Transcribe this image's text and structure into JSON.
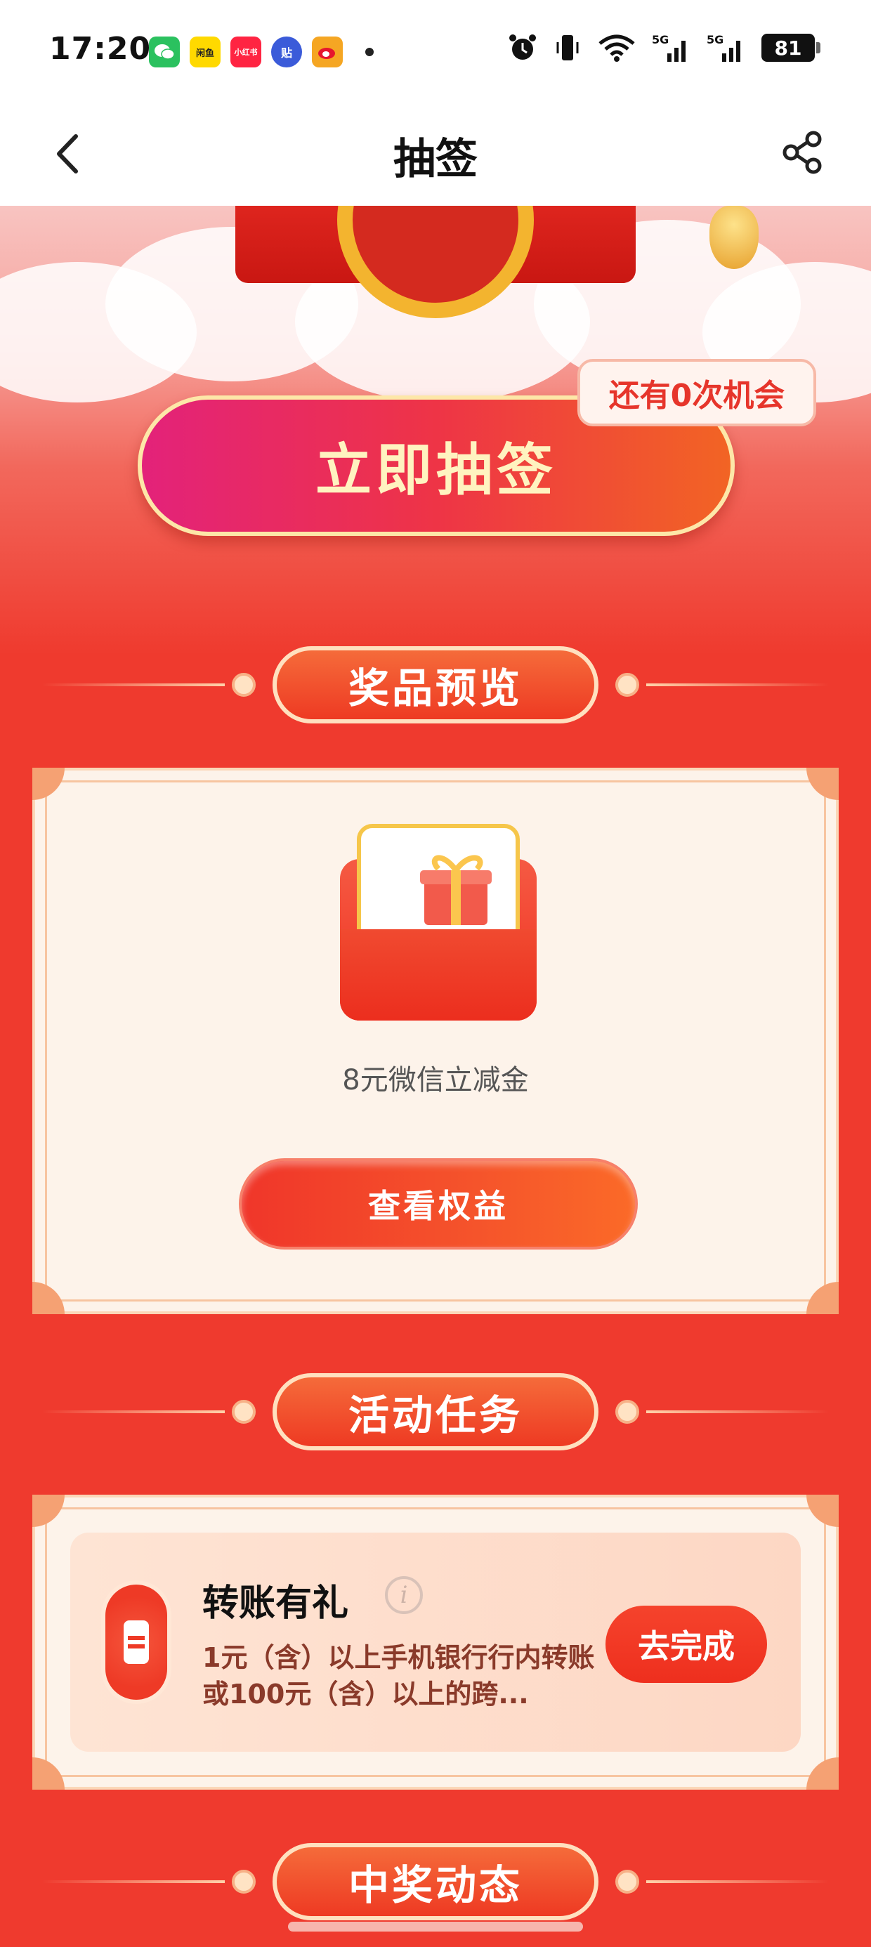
{
  "status_bar": {
    "time": "17:20",
    "apps": [
      {
        "name": "wechat-icon",
        "label": "",
        "color": "#2bc15f"
      },
      {
        "name": "xianyu-icon",
        "label": "闲鱼",
        "color": "#ffd900"
      },
      {
        "name": "xiaohongshu-icon",
        "label": "小红书",
        "color": "#ff2442"
      },
      {
        "name": "tieba-icon",
        "label": "贴",
        "color": "#3b5bd9"
      },
      {
        "name": "weibo-icon",
        "label": "",
        "color": "#f5a623"
      }
    ],
    "battery": "81",
    "signal_1": "5G",
    "signal_2": "5G"
  },
  "nav": {
    "title": "抽签"
  },
  "hero": {
    "chance_text": "还有0次机会",
    "draw_button": "立即抽签"
  },
  "prize_section": {
    "title": "奖品预览",
    "prize_name": "8元微信立减金",
    "view_button": "查看权益"
  },
  "task_section": {
    "title": "活动任务",
    "task": {
      "title": "转账有礼",
      "description": "1元（含）以上手机银行行内转账或100元（含）以上的跨...",
      "button": "去完成"
    }
  },
  "winners_section": {
    "title": "中奖动态"
  },
  "colors": {
    "page_bg": "#ef3a2e",
    "accent": "#ee3a23",
    "card_bg": "#fdf3ea"
  }
}
